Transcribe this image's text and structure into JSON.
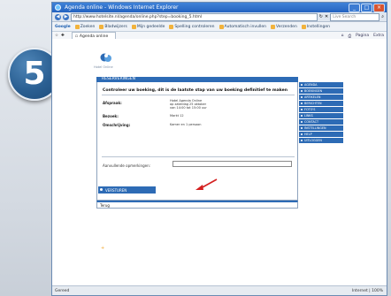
{
  "step": {
    "number": "5"
  },
  "browser": {
    "title": "Agenda online - Windows Internet Explorer",
    "url": "http://www.hotelsite.nl/agenda/online.php?step=booking_5.html",
    "search_placeholder": "Live Search",
    "toolbar_logo": "Google",
    "toolbar_items": [
      "Zoeken",
      "Bladwijzers",
      "Mijn gedeelde",
      "Spelling controleren",
      "Automatisch invullen",
      "Verzenden",
      "Instellingen"
    ],
    "tab_label": "Agenda online",
    "tab_tools": [
      "Pagina",
      "Extra"
    ],
    "status_text": "Gereed",
    "status_zone": "Internet | 100%"
  },
  "page": {
    "logo_text": "Hotel Online",
    "header_bar": "RESERVERINGEN",
    "heading": "Controleer uw boeking, dit is de laatste stap van uw boeking definitief te maken",
    "fields": [
      {
        "label": "Afspraak:",
        "value_lines": [
          "Hotel Agenda Online",
          "op zaterdag 25 oktober",
          "van 14:00 tot 15:00 uur"
        ]
      },
      {
        "label": "Bezoek:",
        "value_lines": [
          "Markt 12"
        ]
      },
      {
        "label": "Omschrijving:",
        "value_lines": [
          "Kamer en 1 persoon"
        ]
      }
    ],
    "note_label": "Aanvullende opmerkingen:",
    "confirm_button": "VERSTUREN",
    "cancel_link": "Terug",
    "footer_mark": "+",
    "sidebar": [
      "AGENDA",
      "BOEKINGEN",
      "ARTIKELEN",
      "BERICHTEN",
      "FOTO'S",
      "LINKS",
      "CONTACT",
      "INSTELLINGEN",
      "HELP",
      "UITLOGGEN"
    ]
  },
  "colors": {
    "accent": "#2d6bb5",
    "arrow": "#d42020",
    "badge": "#2a5f92"
  }
}
